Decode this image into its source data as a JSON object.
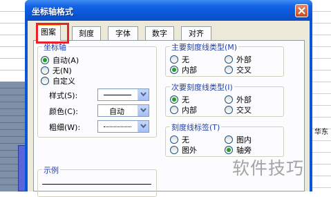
{
  "dialog": {
    "title": "坐标轴格式"
  },
  "tabs": [
    "图案",
    "刻度",
    "字体",
    "数字",
    "对齐"
  ],
  "axis": {
    "group_title": "坐标轴",
    "options": [
      "自动(A)",
      "无(N)",
      "自定义"
    ],
    "selected": "自动(A)",
    "style_label": "样式(S):",
    "color_label": "颜色(C):",
    "color_value": "自动",
    "weight_label": "粗细(W):"
  },
  "sample": {
    "title": "示例"
  },
  "major_tick": {
    "title": "主要刻度线类型(M)",
    "options": [
      "无",
      "外部",
      "内部",
      "交叉"
    ],
    "selected": "内部"
  },
  "minor_tick": {
    "title": "次要刻度线类型(I)",
    "options": [
      "无",
      "外部",
      "内部",
      "交叉"
    ],
    "selected": "无"
  },
  "tick_labels": {
    "title": "刻度线标签(T)",
    "options": [
      "无",
      "图内",
      "图外",
      "轴旁"
    ],
    "selected": "轴旁"
  },
  "background": {
    "right_text": "华东"
  },
  "watermark": "软件技巧"
}
